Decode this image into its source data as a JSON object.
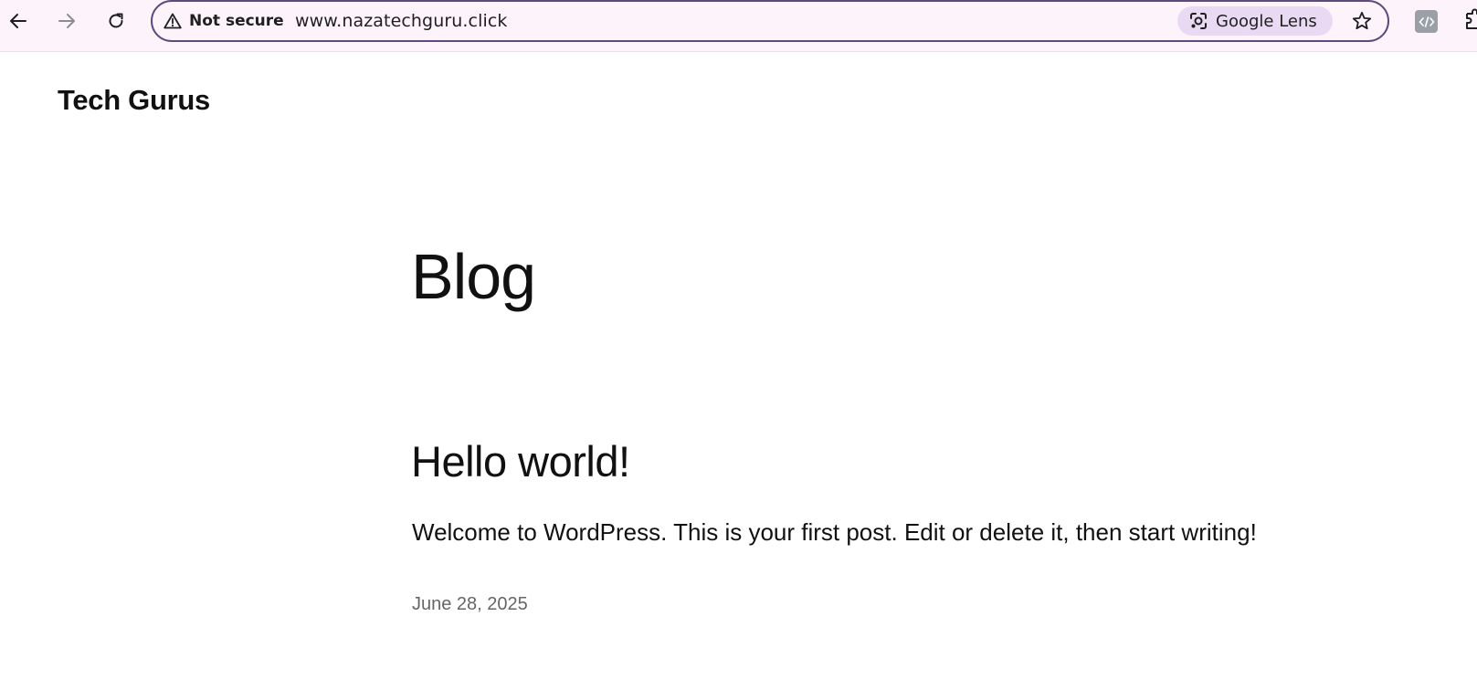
{
  "browser": {
    "security_label": "Not secure",
    "url": "www.nazatechguru.click",
    "lens_label": "Google Lens",
    "accent_color": "#5f4a7e",
    "lens_chip_color": "#ead9f2",
    "icons": {
      "back": "arrow-left-icon",
      "forward": "arrow-right-icon",
      "reload": "reload-icon",
      "warning": "warning-triangle-icon",
      "lens": "camera-lens-icon",
      "bookmark": "star-icon",
      "extension": "code-extension-icon",
      "extensions_menu": "puzzle-icon"
    }
  },
  "site": {
    "title": "Tech Gurus"
  },
  "page": {
    "heading": "Blog"
  },
  "post": {
    "title": "Hello world!",
    "excerpt": "Welcome to WordPress. This is your first post. Edit or delete it, then start writing!",
    "date": "June 28, 2025"
  }
}
